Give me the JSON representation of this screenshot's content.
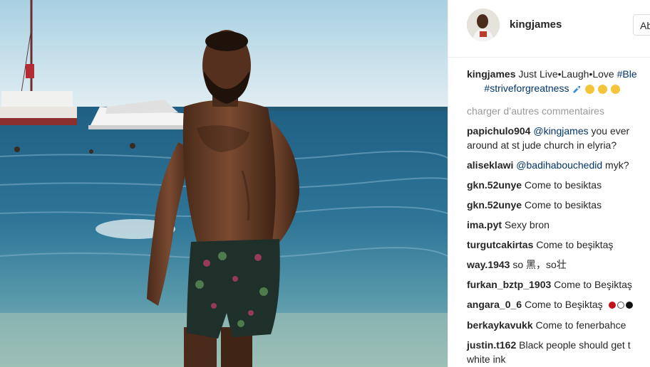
{
  "post": {
    "username": "kingjames",
    "follow_label": "Abonné",
    "caption": {
      "username": "kingjames",
      "text": "Just Live•Laugh•Love",
      "hashtag_1": "#Ble",
      "line2_prefix": "⠀⠀",
      "hashtag_2": "#striveforgreatness"
    },
    "load_more_label": "charger d’autres commentaires"
  },
  "comments": [
    {
      "username": "papichulo904",
      "mention": "@kingjames",
      "text": "you ever",
      "text_line2": "around at st jude church in elyria?"
    },
    {
      "username": "aliseklawi",
      "mention": "@badihabouchedid",
      "text": "myk?"
    },
    {
      "username": "gkn.52unye",
      "text": "Come to besiktas"
    },
    {
      "username": "gkn.52unye",
      "text": "Come to besiktas"
    },
    {
      "username": "ima.pyt",
      "text": "Sexy bron"
    },
    {
      "username": "turgutcakirtas",
      "text": "Come to beşiktaş"
    },
    {
      "username": "way.1943",
      "text": "so 黑，so壮"
    },
    {
      "username": "furkan_bztp_1903",
      "text": "Come to Beşiktaş"
    },
    {
      "username": "angara_0_6",
      "text": "Come to Beşiktaş"
    },
    {
      "username": "berkaykavukk",
      "text": "Come to fenerbahce"
    },
    {
      "username": "justin.t162",
      "text": "Black people should get t",
      "text_line2": "white ink"
    }
  ],
  "colors": {
    "sky": "#cfe3ec",
    "sea": "#2d6f92",
    "username": "#262626",
    "link": "#003569",
    "muted": "#999999"
  }
}
